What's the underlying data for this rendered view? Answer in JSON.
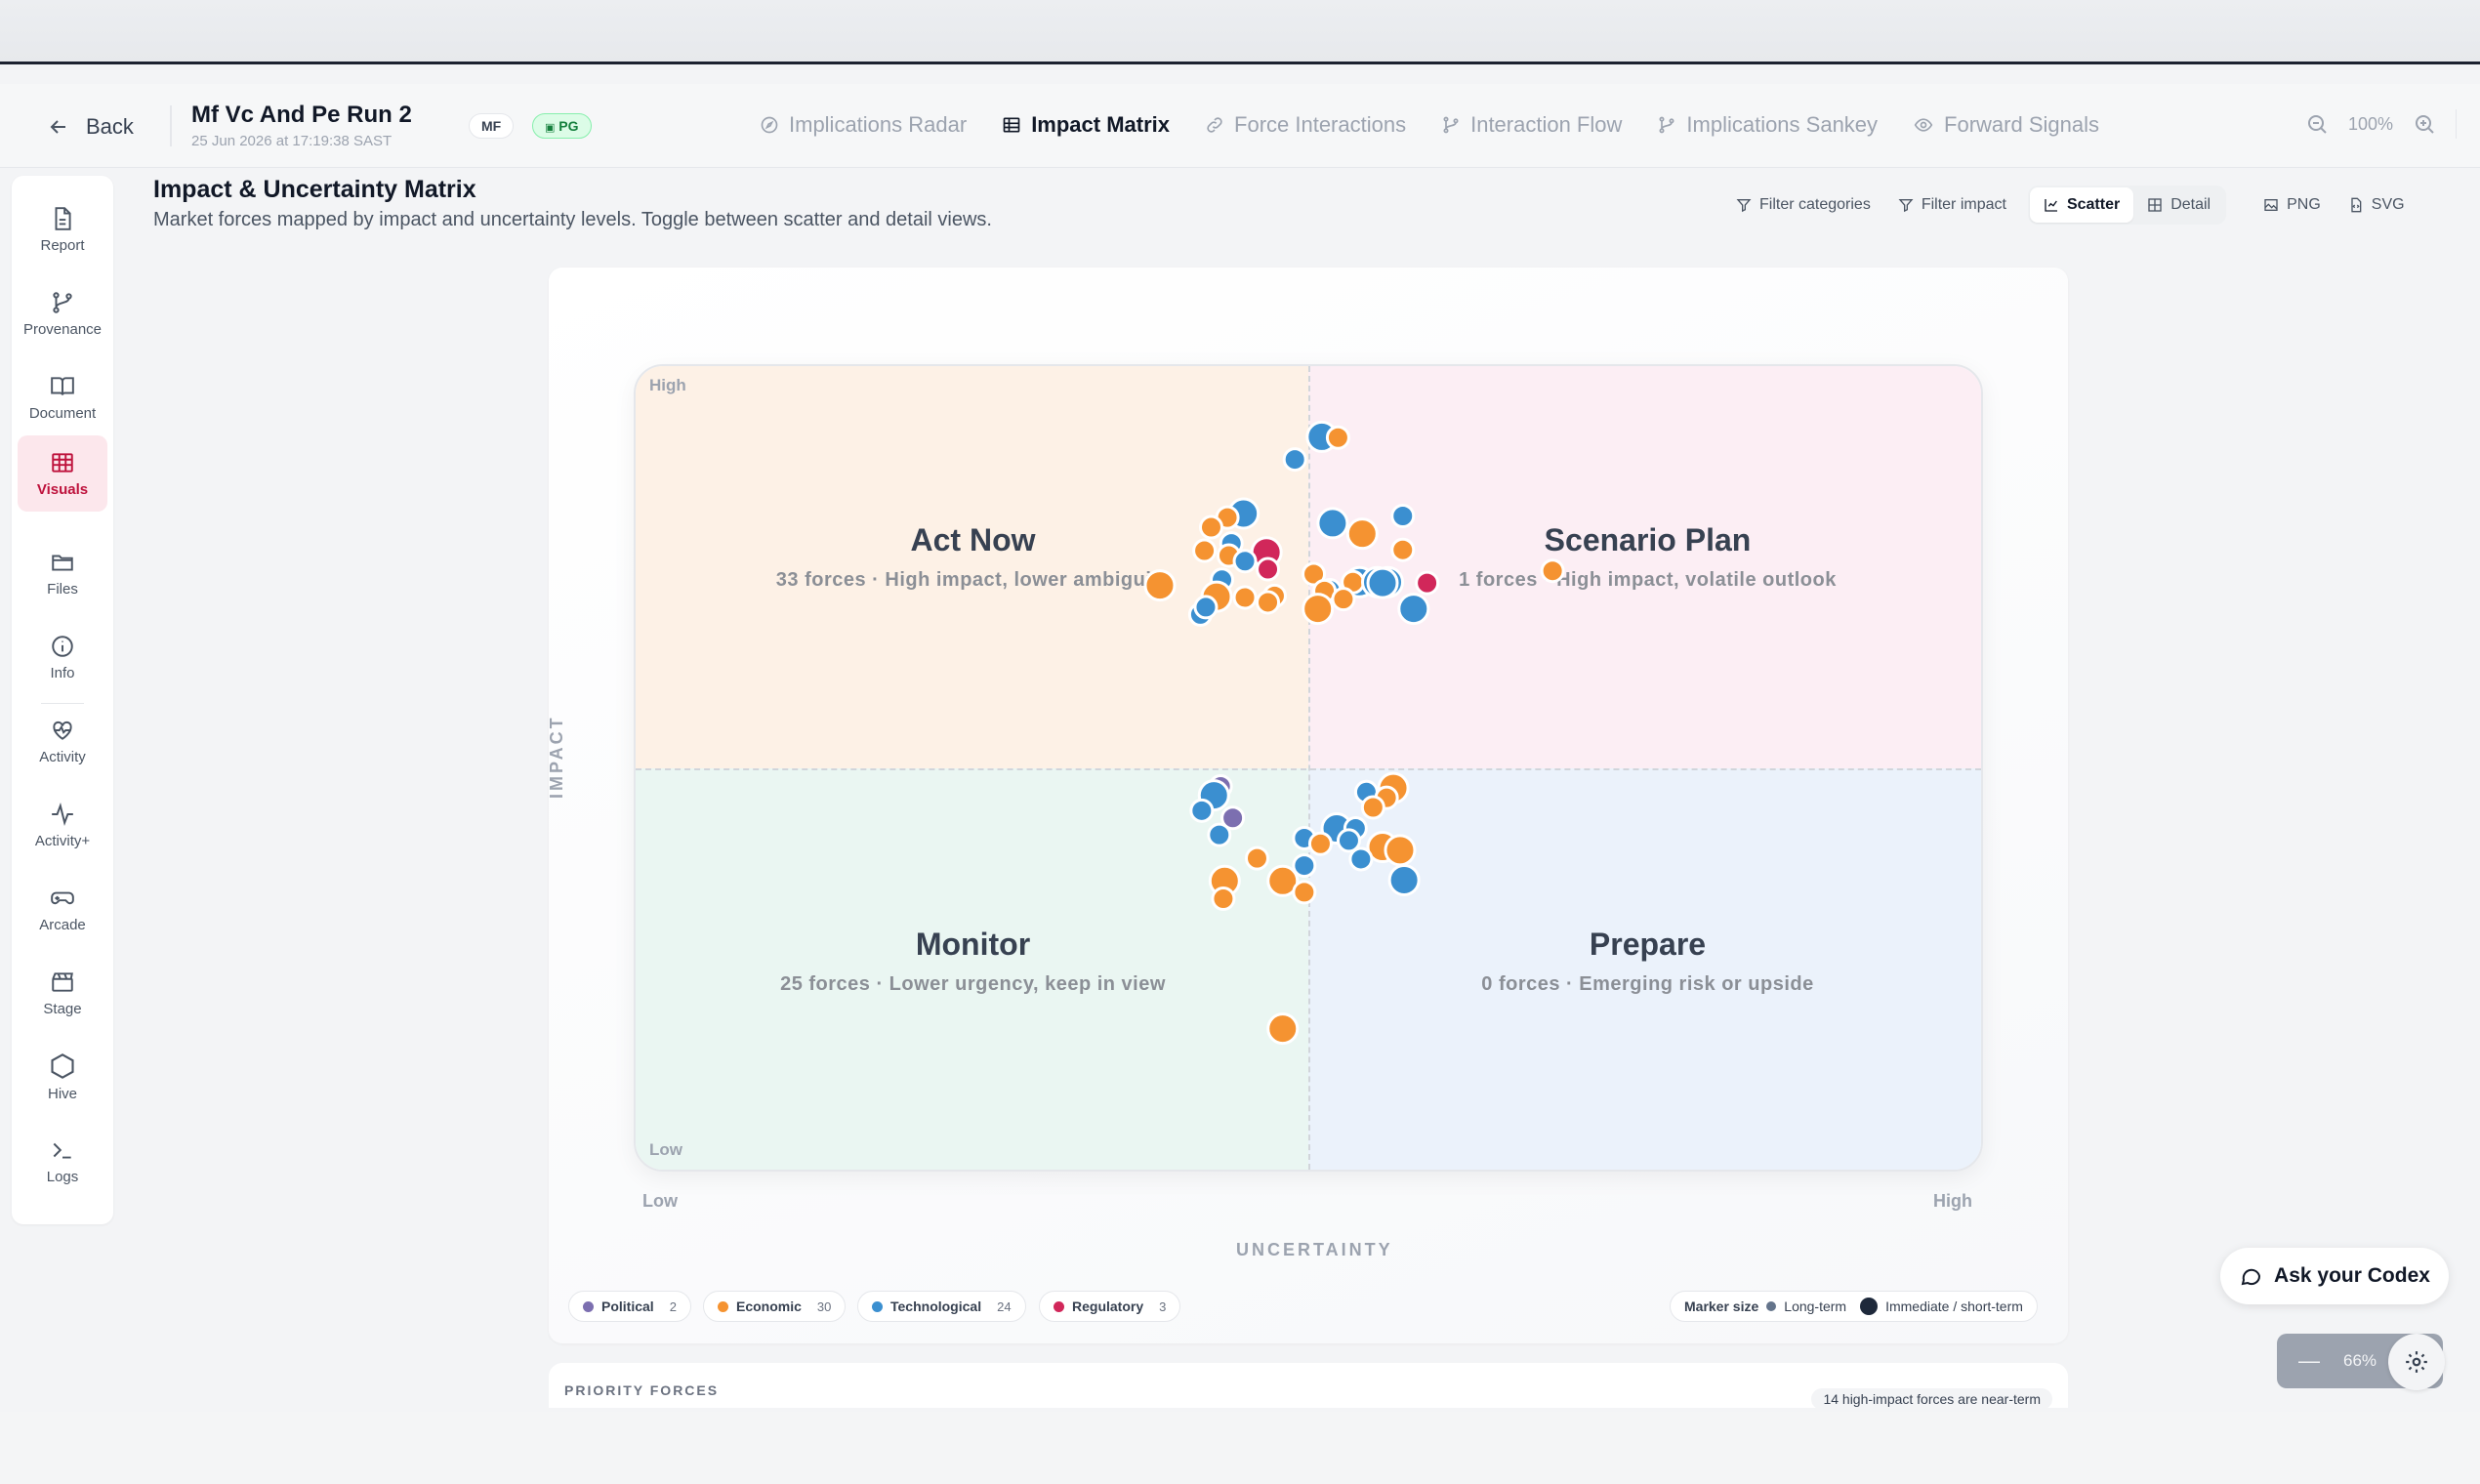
{
  "header": {
    "back_label": "Back",
    "run_title": "Mf Vc And Pe Run 2",
    "run_date": "25 Jun 2026 at 17:19:38 SAST",
    "badge_mf": "MF",
    "badge_pg": "PG",
    "tabs": [
      {
        "label": "Implications Radar",
        "icon": "compass-icon"
      },
      {
        "label": "Impact Matrix",
        "icon": "grid-icon",
        "active": true
      },
      {
        "label": "Force Interactions",
        "icon": "link-icon"
      },
      {
        "label": "Interaction Flow",
        "icon": "branch-icon"
      },
      {
        "label": "Implications Sankey",
        "icon": "branch-icon"
      },
      {
        "label": "Forward Signals",
        "icon": "eye-icon"
      }
    ],
    "zoom_level": "100%"
  },
  "sidebar": {
    "items": [
      {
        "label": "Report",
        "icon": "file-icon"
      },
      {
        "label": "Provenance",
        "icon": "git-branch-icon"
      },
      {
        "label": "Document",
        "icon": "book-icon"
      },
      {
        "label": "Visuals",
        "icon": "table-icon",
        "active": true
      },
      {
        "label": "Files",
        "icon": "folder-icon"
      },
      {
        "label": "Info",
        "icon": "info-icon"
      },
      {
        "label": "Activity",
        "icon": "heart-pulse-icon"
      },
      {
        "label": "Activity+",
        "icon": "activity-icon"
      },
      {
        "label": "Arcade",
        "icon": "gamepad-icon"
      },
      {
        "label": "Stage",
        "icon": "clapperboard-icon"
      },
      {
        "label": "Hive",
        "icon": "hexagon-icon"
      },
      {
        "label": "Logs",
        "icon": "terminal-icon"
      }
    ]
  },
  "page": {
    "title": "Impact & Uncertainty Matrix",
    "subtitle": "Market forces mapped by impact and uncertainty levels. Toggle between scatter and detail views."
  },
  "toolbar": {
    "filter_categories": "Filter categories",
    "filter_impact": "Filter impact",
    "scatter": "Scatter",
    "detail": "Detail",
    "png": "PNG",
    "svg": "SVG"
  },
  "matrix": {
    "corner_high": "High",
    "corner_low": "Low",
    "y_axis_title": "IMPACT",
    "x_axis_title": "UNCERTAINTY",
    "x_low": "Low",
    "x_high": "High",
    "quadrants": {
      "act_now": {
        "title": "Act Now",
        "desc": "33 forces · High impact, lower ambiguity"
      },
      "scenario_plan": {
        "title": "Scenario Plan",
        "desc": "1 forces · High impact, volatile outlook"
      },
      "monitor": {
        "title": "Monitor",
        "desc": "25 forces · Lower urgency, keep in view"
      },
      "prepare": {
        "title": "Prepare",
        "desc": "0 forces · Emerging risk or upside"
      }
    }
  },
  "legend": {
    "categories": [
      {
        "label": "Political",
        "count": "2",
        "color": "#7c6fb0"
      },
      {
        "label": "Economic",
        "count": "30",
        "color": "#f59331"
      },
      {
        "label": "Technological",
        "count": "24",
        "color": "#3b8fd0"
      },
      {
        "label": "Regulatory",
        "count": "3",
        "color": "#d1275a"
      }
    ],
    "marker_size_label": "Marker size",
    "long_term_label": "Long-term",
    "short_term_label": "Immediate / short-term"
  },
  "priority": {
    "label": "PRIORITY FORCES",
    "note": "14 high-impact forces are near-term"
  },
  "assistant": {
    "button_label": "Ask your Codex",
    "zoom": "66%"
  },
  "chart_data": {
    "type": "scatter",
    "xlabel": "UNCERTAINTY",
    "ylabel": "IMPACT",
    "xlim": [
      0,
      1
    ],
    "ylim": [
      0,
      1
    ],
    "points": [
      {
        "x": 0.51,
        "y": 0.91,
        "cat": "Technological",
        "size": "short"
      },
      {
        "x": 0.522,
        "y": 0.909,
        "cat": "Economic",
        "size": "long"
      },
      {
        "x": 0.49,
        "y": 0.882,
        "cat": "Technological",
        "size": "long"
      },
      {
        "x": 0.452,
        "y": 0.815,
        "cat": "Technological",
        "size": "short"
      },
      {
        "x": 0.44,
        "y": 0.81,
        "cat": "Economic",
        "size": "long"
      },
      {
        "x": 0.428,
        "y": 0.798,
        "cat": "Economic",
        "size": "long"
      },
      {
        "x": 0.518,
        "y": 0.803,
        "cat": "Technological",
        "size": "short"
      },
      {
        "x": 0.54,
        "y": 0.79,
        "cat": "Economic",
        "size": "short"
      },
      {
        "x": 0.57,
        "y": 0.812,
        "cat": "Technological",
        "size": "long"
      },
      {
        "x": 0.57,
        "y": 0.77,
        "cat": "Economic",
        "size": "long"
      },
      {
        "x": 0.443,
        "y": 0.778,
        "cat": "Technological",
        "size": "long"
      },
      {
        "x": 0.441,
        "y": 0.763,
        "cat": "Economic",
        "size": "long"
      },
      {
        "x": 0.423,
        "y": 0.769,
        "cat": "Economic",
        "size": "long"
      },
      {
        "x": 0.469,
        "y": 0.767,
        "cat": "Regulatory",
        "size": "short"
      },
      {
        "x": 0.453,
        "y": 0.756,
        "cat": "Technological",
        "size": "long"
      },
      {
        "x": 0.47,
        "y": 0.746,
        "cat": "Regulatory",
        "size": "long"
      },
      {
        "x": 0.39,
        "y": 0.726,
        "cat": "Economic",
        "size": "short"
      },
      {
        "x": 0.504,
        "y": 0.74,
        "cat": "Economic",
        "size": "long"
      },
      {
        "x": 0.436,
        "y": 0.733,
        "cat": "Technological",
        "size": "long"
      },
      {
        "x": 0.516,
        "y": 0.72,
        "cat": "Technological",
        "size": "long"
      },
      {
        "x": 0.512,
        "y": 0.719,
        "cat": "Economic",
        "size": "long"
      },
      {
        "x": 0.538,
        "y": 0.73,
        "cat": "Technological",
        "size": "short"
      },
      {
        "x": 0.559,
        "y": 0.73,
        "cat": "Technological",
        "size": "short"
      },
      {
        "x": 0.533,
        "y": 0.73,
        "cat": "Economic",
        "size": "long"
      },
      {
        "x": 0.551,
        "y": 0.73,
        "cat": "Technological",
        "size": "short"
      },
      {
        "x": 0.555,
        "y": 0.729,
        "cat": "Technological",
        "size": "short"
      },
      {
        "x": 0.588,
        "y": 0.729,
        "cat": "Regulatory",
        "size": "long"
      },
      {
        "x": 0.475,
        "y": 0.713,
        "cat": "Economic",
        "size": "long"
      },
      {
        "x": 0.432,
        "y": 0.712,
        "cat": "Economic",
        "size": "short"
      },
      {
        "x": 0.453,
        "y": 0.711,
        "cat": "Economic",
        "size": "long"
      },
      {
        "x": 0.47,
        "y": 0.705,
        "cat": "Economic",
        "size": "long"
      },
      {
        "x": 0.526,
        "y": 0.709,
        "cat": "Economic",
        "size": "long"
      },
      {
        "x": 0.507,
        "y": 0.697,
        "cat": "Economic",
        "size": "short"
      },
      {
        "x": 0.578,
        "y": 0.697,
        "cat": "Technological",
        "size": "short"
      },
      {
        "x": 0.42,
        "y": 0.69,
        "cat": "Technological",
        "size": "long"
      },
      {
        "x": 0.424,
        "y": 0.699,
        "cat": "Technological",
        "size": "long"
      },
      {
        "x": 0.681,
        "y": 0.744,
        "cat": "Economic",
        "size": "long"
      },
      {
        "x": 0.435,
        "y": 0.477,
        "cat": "Political",
        "size": "long"
      },
      {
        "x": 0.43,
        "y": 0.466,
        "cat": "Technological",
        "size": "short"
      },
      {
        "x": 0.421,
        "y": 0.447,
        "cat": "Technological",
        "size": "long"
      },
      {
        "x": 0.444,
        "y": 0.438,
        "cat": "Political",
        "size": "long"
      },
      {
        "x": 0.434,
        "y": 0.417,
        "cat": "Technological",
        "size": "long"
      },
      {
        "x": 0.543,
        "y": 0.47,
        "cat": "Technological",
        "size": "long"
      },
      {
        "x": 0.563,
        "y": 0.475,
        "cat": "Economic",
        "size": "short"
      },
      {
        "x": 0.558,
        "y": 0.463,
        "cat": "Economic",
        "size": "long"
      },
      {
        "x": 0.548,
        "y": 0.451,
        "cat": "Economic",
        "size": "long"
      },
      {
        "x": 0.521,
        "y": 0.425,
        "cat": "Technological",
        "size": "short"
      },
      {
        "x": 0.535,
        "y": 0.425,
        "cat": "Technological",
        "size": "long"
      },
      {
        "x": 0.497,
        "y": 0.413,
        "cat": "Technological",
        "size": "long"
      },
      {
        "x": 0.509,
        "y": 0.406,
        "cat": "Economic",
        "size": "long"
      },
      {
        "x": 0.53,
        "y": 0.41,
        "cat": "Technological",
        "size": "long"
      },
      {
        "x": 0.555,
        "y": 0.402,
        "cat": "Economic",
        "size": "short"
      },
      {
        "x": 0.568,
        "y": 0.398,
        "cat": "Economic",
        "size": "short"
      },
      {
        "x": 0.539,
        "y": 0.387,
        "cat": "Technological",
        "size": "long"
      },
      {
        "x": 0.462,
        "y": 0.388,
        "cat": "Economic",
        "size": "long"
      },
      {
        "x": 0.497,
        "y": 0.379,
        "cat": "Technological",
        "size": "long"
      },
      {
        "x": 0.481,
        "y": 0.36,
        "cat": "Economic",
        "size": "short"
      },
      {
        "x": 0.438,
        "y": 0.36,
        "cat": "Economic",
        "size": "short"
      },
      {
        "x": 0.571,
        "y": 0.361,
        "cat": "Technological",
        "size": "short"
      },
      {
        "x": 0.497,
        "y": 0.346,
        "cat": "Economic",
        "size": "long"
      },
      {
        "x": 0.437,
        "y": 0.338,
        "cat": "Economic",
        "size": "long"
      },
      {
        "x": 0.481,
        "y": 0.177,
        "cat": "Economic",
        "size": "short"
      }
    ]
  }
}
